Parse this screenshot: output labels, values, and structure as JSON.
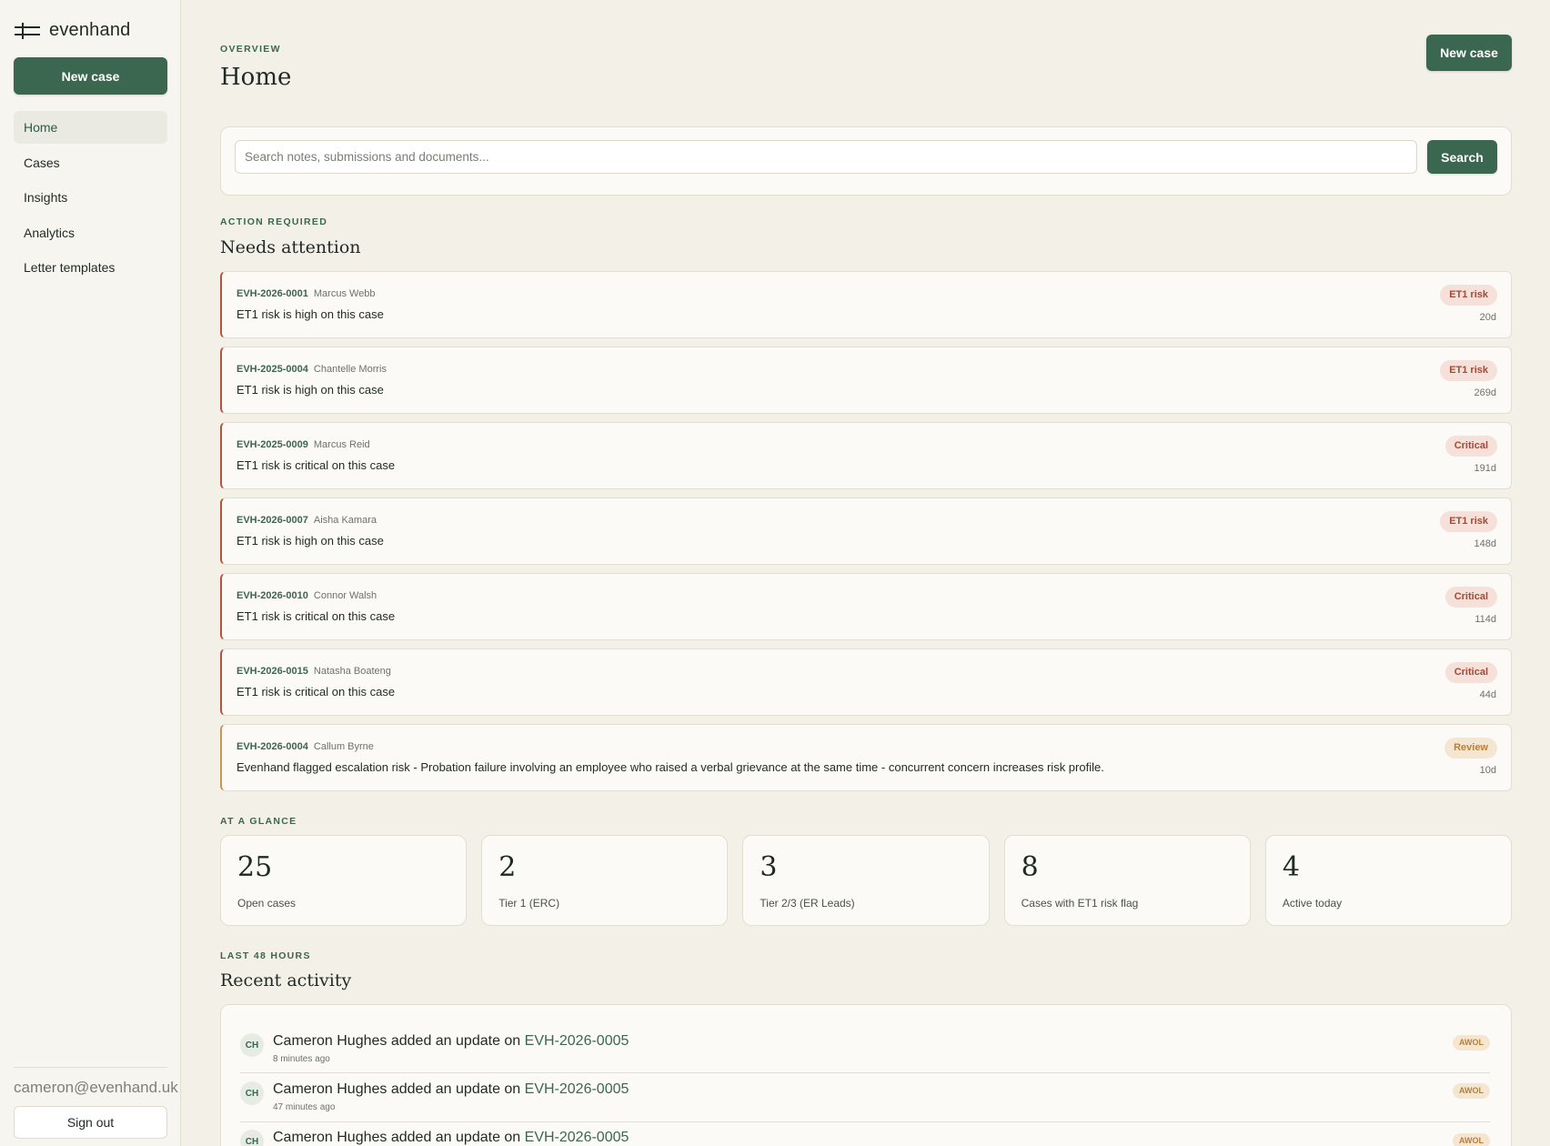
{
  "sidebar": {
    "brand": "evenhand",
    "new_case_label": "New case",
    "nav": [
      "Home",
      "Cases",
      "Insights",
      "Analytics",
      "Letter templates"
    ],
    "active_index": 0,
    "user_email": "cameron@evenhand.uk",
    "sign_out_label": "Sign out"
  },
  "header": {
    "eyebrow": "OVERVIEW",
    "title": "Home",
    "new_case_label": "New case"
  },
  "search": {
    "placeholder": "Search notes, submissions and documents...",
    "button_label": "Search"
  },
  "attention": {
    "eyebrow": "ACTION REQUIRED",
    "title": "Needs attention",
    "items": [
      {
        "id": "EVH-2026-0001",
        "name": "Marcus Webb",
        "message": "ET1 risk is high on this case",
        "badge": "ET1 risk",
        "age": "20d",
        "kind": "risk"
      },
      {
        "id": "EVH-2025-0004",
        "name": "Chantelle Morris",
        "message": "ET1 risk is high on this case",
        "badge": "ET1 risk",
        "age": "269d",
        "kind": "risk"
      },
      {
        "id": "EVH-2025-0009",
        "name": "Marcus Reid",
        "message": "ET1 risk is critical on this case",
        "badge": "Critical",
        "age": "191d",
        "kind": "risk"
      },
      {
        "id": "EVH-2026-0007",
        "name": "Aisha Kamara",
        "message": "ET1 risk is high on this case",
        "badge": "ET1 risk",
        "age": "148d",
        "kind": "risk"
      },
      {
        "id": "EVH-2026-0010",
        "name": "Connor Walsh",
        "message": "ET1 risk is critical on this case",
        "badge": "Critical",
        "age": "114d",
        "kind": "risk"
      },
      {
        "id": "EVH-2026-0015",
        "name": "Natasha Boateng",
        "message": "ET1 risk is critical on this case",
        "badge": "Critical",
        "age": "44d",
        "kind": "risk"
      },
      {
        "id": "EVH-2026-0004",
        "name": "Callum Byrne",
        "message": "Evenhand flagged escalation risk - Probation failure involving an employee who raised a verbal grievance at the same time - concurrent concern increases risk profile.",
        "badge": "Review",
        "age": "10d",
        "kind": "review"
      }
    ]
  },
  "glance": {
    "eyebrow": "AT A GLANCE",
    "stats": [
      {
        "value": "25",
        "label": "Open cases"
      },
      {
        "value": "2",
        "label": "Tier 1 (ERC)"
      },
      {
        "value": "3",
        "label": "Tier 2/3 (ER Leads)"
      },
      {
        "value": "8",
        "label": "Cases with ET1 risk flag"
      },
      {
        "value": "4",
        "label": "Active today"
      }
    ]
  },
  "recent": {
    "eyebrow": "LAST 48 HOURS",
    "title": "Recent activity",
    "items": [
      {
        "initials": "CH",
        "text": "Cameron Hughes added an update on",
        "case": "EVH-2026-0005",
        "time": "8 minutes ago",
        "tag": "AWOL"
      },
      {
        "initials": "CH",
        "text": "Cameron Hughes added an update on",
        "case": "EVH-2026-0005",
        "time": "47 minutes ago",
        "tag": "AWOL"
      },
      {
        "initials": "CH",
        "text": "Cameron Hughes added an update on",
        "case": "EVH-2026-0005",
        "time": "",
        "tag": "AWOL"
      }
    ]
  },
  "colors": {
    "accent": "#3b6650",
    "risk": "#b5533d",
    "review": "#c99752",
    "background": "#f3f0e8"
  }
}
